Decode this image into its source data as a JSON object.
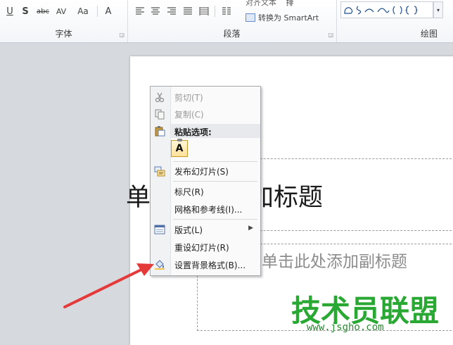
{
  "ribbon": {
    "font_group_label": "字体",
    "paragraph_group_label": "段落",
    "drawing_group_label": "绘图",
    "text_align_cut": "对齐文本",
    "convert_smartart": "转换为 SmartArt",
    "text_direction_cut": "排"
  },
  "slide": {
    "title_placeholder": "单击此处添加标题",
    "subtitle_placeholder": "单击此处添加副标题"
  },
  "context_menu": {
    "items": [
      {
        "label": "剪切(T)",
        "enabled": false,
        "icon": "scissors-icon"
      },
      {
        "label": "复制(C)",
        "enabled": false,
        "icon": "copy-icon"
      },
      {
        "label": "粘贴选项:",
        "header": true,
        "icon": "paste-icon"
      },
      {
        "label": "发布幻灯片(S)",
        "icon": "publish-slides-icon"
      },
      {
        "label": "标尺(R)"
      },
      {
        "label": "网格和参考线(I)..."
      },
      {
        "label": "版式(L)",
        "submenu": true,
        "icon": "layout-icon"
      },
      {
        "label": "重设幻灯片(R)"
      },
      {
        "label": "设置背景格式(B)...",
        "icon": "paint-bucket-icon"
      }
    ],
    "paste_keep_text_label": "A"
  },
  "watermark": {
    "brand": "技术员联盟",
    "url": "www.jsgho.com"
  },
  "colors": {
    "accent_red": "#e53a3a",
    "watermark_green": "#2aa834"
  }
}
